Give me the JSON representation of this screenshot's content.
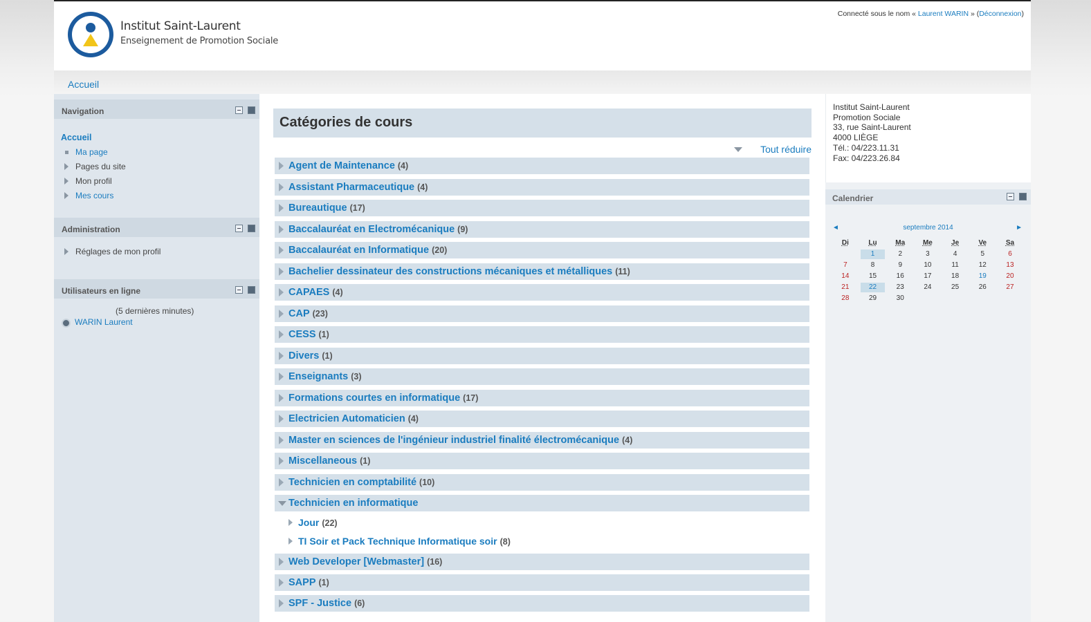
{
  "header": {
    "site_title": "Institut Saint-Laurent",
    "site_subtitle": "Enseignement de Promotion Sociale",
    "login_prefix": "Connecté sous le nom « ",
    "login_user": "Laurent WARIN",
    "login_mid": " » (",
    "logout": "Déconnexion",
    "login_suffix": ")"
  },
  "breadcrumb": {
    "home": "Accueil"
  },
  "navigation": {
    "title": "Navigation",
    "home": "Accueil",
    "items": [
      "Ma page",
      "Pages du site",
      "Mon profil",
      "Mes cours"
    ]
  },
  "administration": {
    "title": "Administration",
    "items": [
      "Réglages de mon profil"
    ]
  },
  "online_users": {
    "title": "Utilisateurs en ligne",
    "period": "(5 dernières minutes)",
    "users": [
      "WARIN Laurent"
    ]
  },
  "main": {
    "heading": "Catégories de cours",
    "collapse_all": "Tout réduire",
    "categories": [
      {
        "name": "Agent de Maintenance",
        "count": "(4)"
      },
      {
        "name": "Assistant Pharmaceutique",
        "count": "(4)"
      },
      {
        "name": "Bureautique",
        "count": "(17)"
      },
      {
        "name": "Baccalauréat en Electromécanique",
        "count": "(9)"
      },
      {
        "name": "Baccalauréat en Informatique",
        "count": "(20)"
      },
      {
        "name": "Bachelier dessinateur des constructions mécaniques et métalliques",
        "count": "(11)"
      },
      {
        "name": "CAPAES",
        "count": "(4)"
      },
      {
        "name": "CAP",
        "count": "(23)"
      },
      {
        "name": "CESS",
        "count": "(1)"
      },
      {
        "name": "Divers",
        "count": "(1)"
      },
      {
        "name": "Enseignants",
        "count": "(3)"
      },
      {
        "name": "Formations courtes en informatique",
        "count": "(17)"
      },
      {
        "name": "Electricien Automaticien",
        "count": "(4)"
      },
      {
        "name": "Master en sciences de l'ingénieur industriel finalité électromécanique",
        "count": "(4)"
      },
      {
        "name": "Miscellaneous",
        "count": "(1)"
      },
      {
        "name": "Technicien en comptabilité",
        "count": "(10)"
      },
      {
        "name": "Technicien en informatique",
        "count": ""
      },
      {
        "name": "Web Developer [Webmaster]",
        "count": "(16)"
      },
      {
        "name": "SAPP",
        "count": "(1)"
      },
      {
        "name": "SPF - Justice",
        "count": "(6)"
      }
    ],
    "subcategories": [
      {
        "name": "Jour",
        "count": "(22)"
      },
      {
        "name": "TI Soir et Pack Technique Informatique soir",
        "count": "(8)"
      }
    ]
  },
  "address": {
    "lines": [
      "Institut Saint-Laurent",
      "Promotion Sociale",
      "33, rue Saint-Laurent",
      "4000 LIÈGE",
      "Tél.: 04/223.11.31",
      "Fax: 04/223.26.84"
    ]
  },
  "calendar": {
    "title": "Calendrier",
    "month": "septembre 2014",
    "prev": "◄",
    "next": "►",
    "days": [
      "Di",
      "Lu",
      "Ma",
      "Me",
      "Je",
      "Ve",
      "Sa"
    ],
    "weeks": [
      [
        "",
        "1",
        "2",
        "3",
        "4",
        "5",
        "6"
      ],
      [
        "7",
        "8",
        "9",
        "10",
        "11",
        "12",
        "13"
      ],
      [
        "14",
        "15",
        "16",
        "17",
        "18",
        "19",
        "20"
      ],
      [
        "21",
        "22",
        "23",
        "24",
        "25",
        "26",
        "27"
      ],
      [
        "28",
        "29",
        "30",
        "",
        "",
        "",
        ""
      ]
    ]
  }
}
